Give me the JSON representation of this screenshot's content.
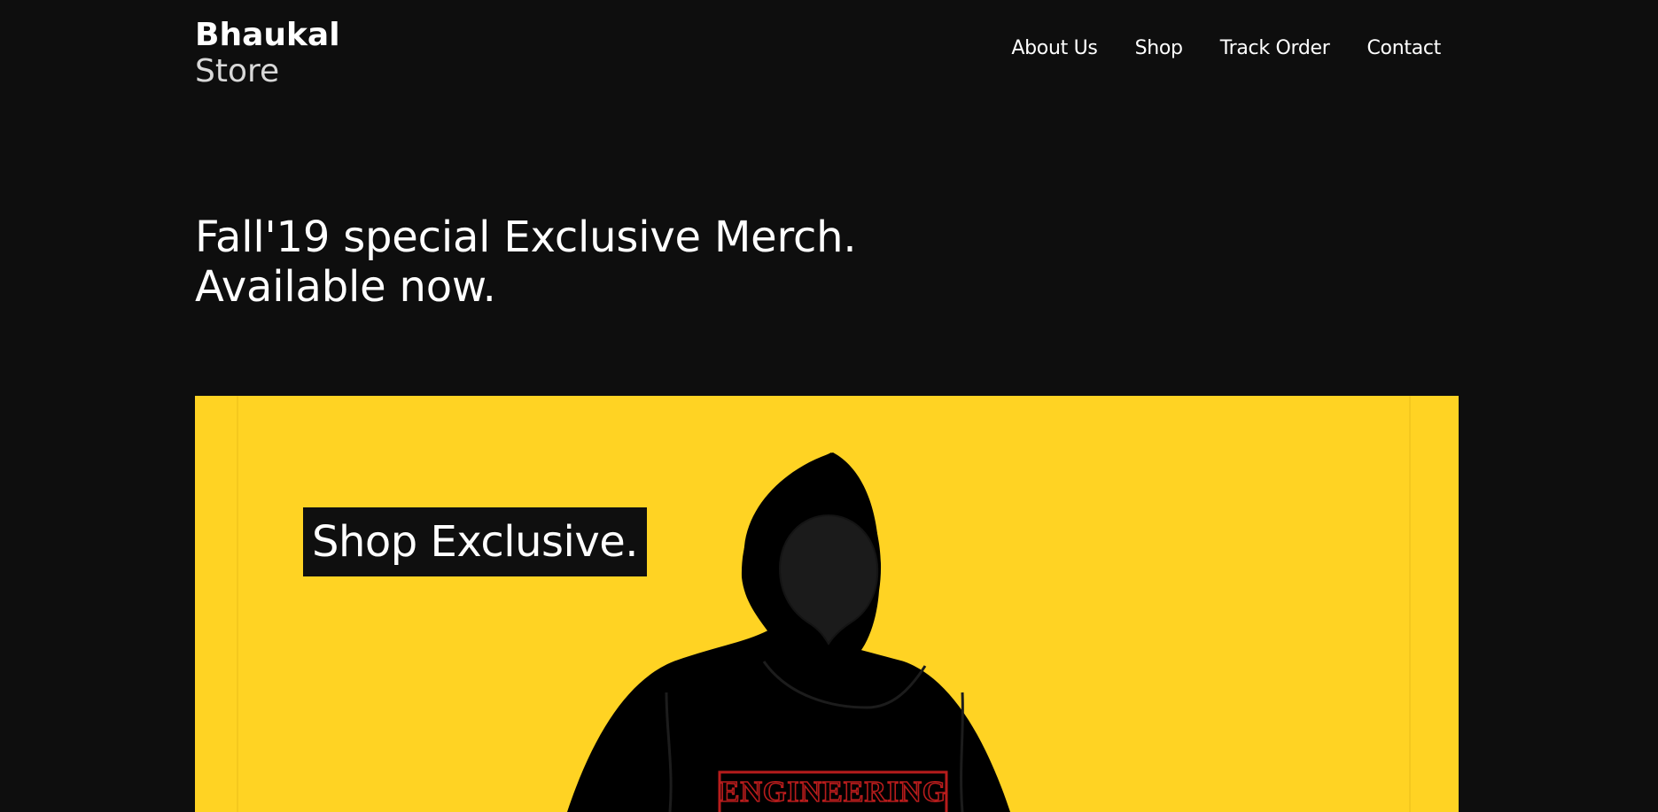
{
  "header": {
    "brand_line1": "Bhaukal",
    "brand_line2": "Store",
    "nav": [
      {
        "label": "About Us"
      },
      {
        "label": "Shop"
      },
      {
        "label": "Track Order"
      },
      {
        "label": "Contact"
      }
    ]
  },
  "hero": {
    "headline_line1": "Fall'19 special Exclusive Merch.",
    "headline_line2": "Available now."
  },
  "banner": {
    "cta_label": "Shop Exclusive.",
    "shirt_print": "ENGINEERING",
    "colors": {
      "background": "#ffd323",
      "hoodie": "#000000",
      "print": "#b71c1c"
    }
  }
}
